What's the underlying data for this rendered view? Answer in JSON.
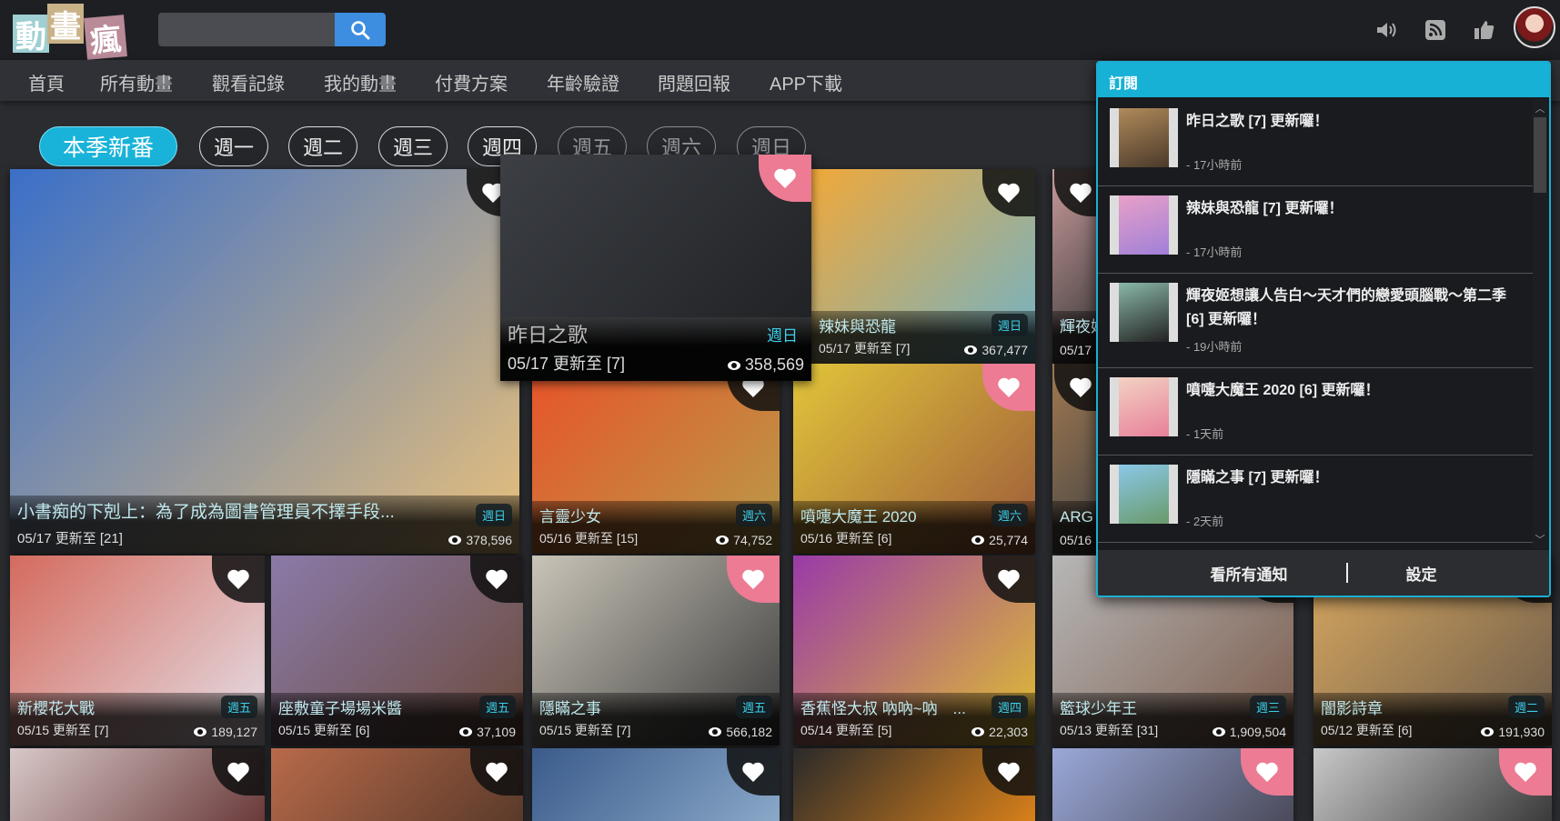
{
  "logo": {
    "chars": [
      "動",
      "畫",
      "瘋"
    ],
    "colors": [
      "#9fcfd2",
      "#c9b287",
      "#b98a98"
    ]
  },
  "search": {
    "value": "",
    "placeholder": ""
  },
  "header_icons": [
    "speaker-icon",
    "rss-icon",
    "thumbs-up-icon",
    "avatar"
  ],
  "nav": [
    "首頁",
    "所有動畫",
    "觀看記錄",
    "我的動畫",
    "付費方案",
    "年齡驗證",
    "問題回報",
    "APP下載"
  ],
  "day_filters": {
    "active": "本季新番",
    "days": [
      "週一",
      "週二",
      "週三",
      "週四",
      "週五",
      "週六",
      "週日"
    ]
  },
  "cards": [
    {
      "title": "小書痴的下剋上：為了成為圖書管理員不擇手段...",
      "day": "週日",
      "date": "05/17 更新至 [21]",
      "views": "378,596",
      "fav": false,
      "colors": [
        "#3a6fc8",
        "#e9c07a"
      ]
    },
    {
      "title": "昨日之歌",
      "day": "週日",
      "date": "05/17 更新至 [7]",
      "views": "358,569",
      "fav": true,
      "colors": [
        "#3c3f44",
        "#1d1f22"
      ]
    },
    {
      "title": "辣妹與恐龍",
      "day": "週日",
      "date": "05/17 更新至 [7]",
      "views": "367,477",
      "fav": false,
      "colors": [
        "#f0a83a",
        "#6fb3c9"
      ]
    },
    {
      "title": "輝夜姬",
      "day": "",
      "date": "05/17",
      "views": "",
      "fav": false,
      "colors": [
        "#c79a9a",
        "#333"
      ]
    },
    {
      "title": "言靈少女",
      "day": "週六",
      "date": "05/16 更新至 [15]",
      "views": "74,752",
      "fav": false,
      "colors": [
        "#e8532a",
        "#b89c4a"
      ]
    },
    {
      "title": "噴嚏大魔王 2020",
      "day": "週六",
      "date": "05/16 更新至 [6]",
      "views": "25,774",
      "fav": true,
      "colors": [
        "#e2c53a",
        "#9c5a3a"
      ]
    },
    {
      "title": "ARG",
      "day": "",
      "date": "05/16",
      "views": "",
      "fav": false,
      "colors": [
        "#a07850",
        "#444"
      ]
    },
    {
      "title": "新櫻花大戰",
      "day": "週五",
      "date": "05/15 更新至 [7]",
      "views": "189,127",
      "fav": false,
      "colors": [
        "#d46b5e",
        "#e5e0e8"
      ]
    },
    {
      "title": "座敷童子場場米醬",
      "day": "週五",
      "date": "05/15 更新至 [6]",
      "views": "37,109",
      "fav": false,
      "colors": [
        "#8a7aa8",
        "#6b4a3a"
      ]
    },
    {
      "title": "隱瞞之事",
      "day": "週五",
      "date": "05/15 更新至 [7]",
      "views": "566,182",
      "fav": true,
      "colors": [
        "#c9c4b8",
        "#3a3a3a"
      ]
    },
    {
      "title": "香蕉怪大叔 吶吶~吶　...",
      "day": "週四",
      "date": "05/14 更新至 [5]",
      "views": "22,303",
      "fav": false,
      "colors": [
        "#9a3aa8",
        "#e0c030"
      ]
    },
    {
      "title": "籃球少年王",
      "day": "週三",
      "date": "05/13 更新至 [31]",
      "views": "1,909,504",
      "fav": false,
      "colors": [
        "#b7b7b7",
        "#7a5a4a"
      ]
    },
    {
      "title": "闇影詩章",
      "day": "週二",
      "date": "05/12 更新至 [6]",
      "views": "191,930",
      "fav": false,
      "colors": [
        "#d8a860",
        "#6a5a4a"
      ]
    },
    {
      "title": "",
      "day": "",
      "date": "",
      "views": "",
      "fav": false,
      "colors": [
        "#d8c8c8",
        "#6a3a3a"
      ]
    },
    {
      "title": "",
      "day": "",
      "date": "",
      "views": "",
      "fav": false,
      "colors": [
        "#b86a4a",
        "#5a3a2a"
      ]
    },
    {
      "title": "",
      "day": "",
      "date": "",
      "views": "",
      "fav": false,
      "colors": [
        "#3a5a8a",
        "#8aa8c8"
      ]
    },
    {
      "title": "",
      "day": "",
      "date": "",
      "views": "",
      "fav": false,
      "colors": [
        "#2a2a2a",
        "#d8801a"
      ]
    },
    {
      "title": "",
      "day": "",
      "date": "",
      "views": "",
      "fav": true,
      "colors": [
        "#9aa8d8",
        "#4a4a5a"
      ]
    },
    {
      "title": "",
      "day": "",
      "date": "",
      "views": "",
      "fav": true,
      "colors": [
        "#c8c8c8",
        "#3a3a3a"
      ]
    }
  ],
  "notifications": {
    "title": "訂閱",
    "items": [
      {
        "text": "昨日之歌 [7] 更新囉！",
        "time": "- 17小時前",
        "colors": [
          "#b08a5a",
          "#4a3a2a"
        ]
      },
      {
        "text": "辣妹與恐龍 [7] 更新囉！",
        "time": "- 17小時前",
        "colors": [
          "#e8a0c8",
          "#a080d8"
        ]
      },
      {
        "text": "輝夜姬想讓人告白～天才們的戀愛頭腦戰～第二季 [6] 更新囉！",
        "time": "- 19小時前",
        "colors": [
          "#8ab8a8",
          "#222"
        ]
      },
      {
        "text": "噴嚏大魔王 2020 [6] 更新囉！",
        "time": "- 1天前",
        "colors": [
          "#f2d2c2",
          "#e8809a"
        ]
      },
      {
        "text": "隱瞞之事 [7] 更新囉！",
        "time": "- 2天前",
        "colors": [
          "#8ac8e8",
          "#6a9a6a"
        ]
      }
    ],
    "view_all": "看所有通知",
    "settings": "設定"
  }
}
